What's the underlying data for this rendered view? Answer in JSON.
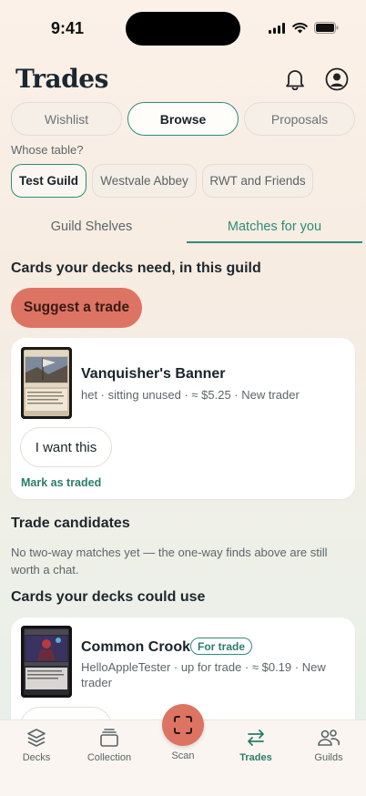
{
  "status": {
    "time": "9:41"
  },
  "header": {
    "title": "Trades",
    "icons": [
      "bell-icon",
      "profile-icon"
    ]
  },
  "segments": [
    {
      "label": "Wishlist",
      "active": false
    },
    {
      "label": "Browse",
      "active": true
    },
    {
      "label": "Proposals",
      "active": false
    }
  ],
  "whose_table": {
    "label": "Whose table?",
    "chips": [
      {
        "label": "Test Guild",
        "active": true
      },
      {
        "label": "Westvale Abbey",
        "active": false
      },
      {
        "label": "RWT and Friends",
        "active": false
      }
    ]
  },
  "tabs": [
    {
      "label": "Guild Shelves",
      "active": false
    },
    {
      "label": "Matches for you",
      "active": true
    }
  ],
  "needs_section": {
    "heading": "Cards your decks need, in this guild",
    "suggest_label": "Suggest a trade",
    "card": {
      "name": "Vanquisher's Banner",
      "meta": "het · sitting unused · ≈ $5.25 · New trader",
      "want_label": "I want this",
      "mark_label": "Mark as traded"
    }
  },
  "candidates": {
    "heading": "Trade candidates",
    "text": "No two-way matches yet — the one-way finds above are still worth a chat."
  },
  "could_use": {
    "heading": "Cards your decks could use",
    "card": {
      "name": "Common Crook",
      "badge": "For trade",
      "meta": "HelloAppleTester · up for trade · ≈ $0.19 · New trader"
    }
  },
  "tabbar": {
    "items": [
      {
        "label": "Decks",
        "icon": "decks-icon",
        "active": false
      },
      {
        "label": "Collection",
        "icon": "collection-icon",
        "active": false
      },
      {
        "label": "Scan",
        "icon": "scan-icon",
        "active": false
      },
      {
        "label": "Trades",
        "icon": "trades-icon",
        "active": true
      },
      {
        "label": "Guilds",
        "icon": "guilds-icon",
        "active": false
      }
    ]
  },
  "colors": {
    "accent": "#2f8c78",
    "primary": "#dd7463",
    "background": "#fbf1e8"
  }
}
